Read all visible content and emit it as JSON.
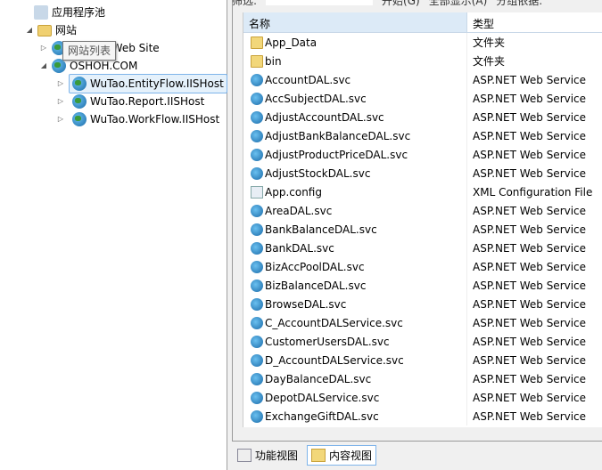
{
  "tree": {
    "items": [
      {
        "label": "应用程序池",
        "icon": "app-pool-icon"
      },
      {
        "label": "网站",
        "icon": "sites-folder-icon",
        "expanded": true
      },
      {
        "label": "Default Web Site",
        "visible_label": "Web Site",
        "icon": "globe-icon"
      },
      {
        "label": "OSHOH.COM",
        "icon": "globe-icon",
        "expanded": true
      },
      {
        "label": "WuTao.EntityFlow.IISHost",
        "icon": "application-icon",
        "selected": true
      },
      {
        "label": "WuTao.Report.IISHost",
        "icon": "application-icon"
      },
      {
        "label": "WuTao.WorkFlow.IISHost",
        "icon": "application-icon"
      }
    ],
    "tooltip": "网站列表"
  },
  "toolbar": {
    "filter_label": "筛选:",
    "start_label": "开始(G)",
    "show_all_label": "全部显示(A)",
    "group_by_label": "分组依据:"
  },
  "list": {
    "columns": [
      "名称",
      "类型"
    ],
    "rows": [
      {
        "name": "App_Data",
        "type": "文件夹",
        "icon": "folder"
      },
      {
        "name": "bin",
        "type": "文件夹",
        "icon": "folder"
      },
      {
        "name": "AccountDAL.svc",
        "type": "ASP.NET Web Service",
        "icon": "svc"
      },
      {
        "name": "AccSubjectDAL.svc",
        "type": "ASP.NET Web Service",
        "icon": "svc"
      },
      {
        "name": "AdjustAccountDAL.svc",
        "type": "ASP.NET Web Service",
        "icon": "svc"
      },
      {
        "name": "AdjustBankBalanceDAL.svc",
        "type": "ASP.NET Web Service",
        "icon": "svc"
      },
      {
        "name": "AdjustProductPriceDAL.svc",
        "type": "ASP.NET Web Service",
        "icon": "svc"
      },
      {
        "name": "AdjustStockDAL.svc",
        "type": "ASP.NET Web Service",
        "icon": "svc"
      },
      {
        "name": "App.config",
        "type": "XML Configuration File",
        "icon": "config"
      },
      {
        "name": "AreaDAL.svc",
        "type": "ASP.NET Web Service",
        "icon": "svc"
      },
      {
        "name": "BankBalanceDAL.svc",
        "type": "ASP.NET Web Service",
        "icon": "svc"
      },
      {
        "name": "BankDAL.svc",
        "type": "ASP.NET Web Service",
        "icon": "svc"
      },
      {
        "name": "BizAccPoolDAL.svc",
        "type": "ASP.NET Web Service",
        "icon": "svc"
      },
      {
        "name": "BizBalanceDAL.svc",
        "type": "ASP.NET Web Service",
        "icon": "svc"
      },
      {
        "name": "BrowseDAL.svc",
        "type": "ASP.NET Web Service",
        "icon": "svc"
      },
      {
        "name": "C_AccountDALService.svc",
        "type": "ASP.NET Web Service",
        "icon": "svc"
      },
      {
        "name": "CustomerUsersDAL.svc",
        "type": "ASP.NET Web Service",
        "icon": "svc"
      },
      {
        "name": "D_AccountDALService.svc",
        "type": "ASP.NET Web Service",
        "icon": "svc"
      },
      {
        "name": "DayBalanceDAL.svc",
        "type": "ASP.NET Web Service",
        "icon": "svc"
      },
      {
        "name": "DepotDALService.svc",
        "type": "ASP.NET Web Service",
        "icon": "svc"
      },
      {
        "name": "ExchangeGiftDAL.svc",
        "type": "ASP.NET Web Service",
        "icon": "svc"
      }
    ]
  },
  "tabs": [
    {
      "label": "功能视图",
      "active": false
    },
    {
      "label": "内容视图",
      "active": true
    }
  ]
}
